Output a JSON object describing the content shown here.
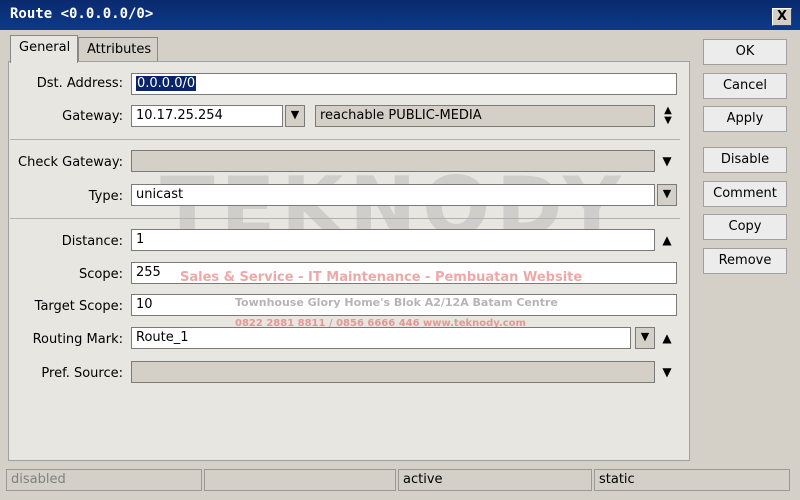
{
  "window": {
    "title": "Route <0.0.0.0/0>",
    "close_glyph": "X"
  },
  "tabs": [
    {
      "label": "General",
      "active": true
    },
    {
      "label": "Attributes",
      "active": false
    }
  ],
  "form": {
    "dst_address": {
      "label": "Dst. Address:",
      "value": "0.0.0.0/0"
    },
    "gateway": {
      "label": "Gateway:",
      "value": "10.17.25.254",
      "status": "reachable PUBLIC-MEDIA"
    },
    "check_gateway": {
      "label": "Check Gateway:",
      "value": ""
    },
    "type": {
      "label": "Type:",
      "value": "unicast"
    },
    "distance": {
      "label": "Distance:",
      "value": "1"
    },
    "scope": {
      "label": "Scope:",
      "value": "255"
    },
    "target_scope": {
      "label": "Target Scope:",
      "value": "10"
    },
    "routing_mark": {
      "label": "Routing Mark:",
      "value": "Route_1"
    },
    "pref_source": {
      "label": "Pref. Source:",
      "value": ""
    }
  },
  "buttons": {
    "ok": "OK",
    "cancel": "Cancel",
    "apply": "Apply",
    "disable": "Disable",
    "comment": "Comment",
    "copy": "Copy",
    "remove": "Remove"
  },
  "status": {
    "left": "disabled",
    "middle": "",
    "state": "active",
    "kind": "static"
  },
  "watermark": {
    "brand": "TEKNODY",
    "line1": "Sales & Service - IT Maintenance - Pembuatan Website",
    "line2": "Townhouse Glory Home's Blok A2/12A Batam Centre",
    "line3": "0822 2881 8811 / 0856 6666 446  www.teknody.com"
  },
  "icons": {
    "dropdown": "dropdown-icon",
    "updown": "updown-arrows-icon",
    "up": "up-arrow-icon",
    "down": "down-arrow-icon"
  }
}
